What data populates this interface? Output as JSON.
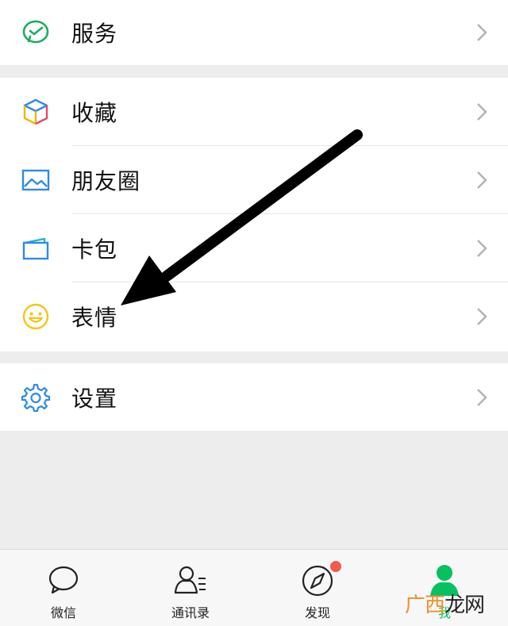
{
  "menu": {
    "services": {
      "label": "服务",
      "icon": "wechat-pay-icon"
    },
    "favorites": {
      "label": "收藏",
      "icon": "cube-icon"
    },
    "moments": {
      "label": "朋友圈",
      "icon": "picture-icon"
    },
    "cards": {
      "label": "卡包",
      "icon": "card-wallet-icon"
    },
    "stickers": {
      "label": "表情",
      "icon": "smiley-icon"
    },
    "settings": {
      "label": "设置",
      "icon": "gear-icon"
    }
  },
  "tabbar": {
    "chats": "微信",
    "contacts": "通讯录",
    "discover": "发现",
    "me": "我"
  },
  "watermark": {
    "a": "广西",
    "b": "龙网"
  },
  "colors": {
    "accent_green": "#07c160",
    "badge_red": "#f25a4f",
    "background": "#ededed"
  }
}
